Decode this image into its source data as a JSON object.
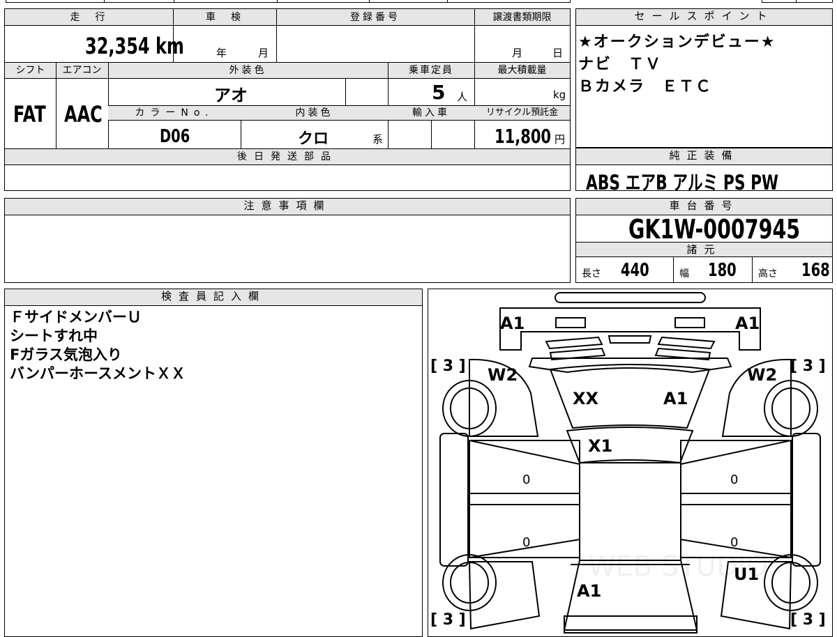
{
  "vehicle": {
    "mileage_label": "走　行",
    "mileage_value": "32,354 km",
    "inspection_label": "車　検",
    "inspection_year": "年",
    "inspection_month": "月",
    "registration_label": "登録番号",
    "transfer_label": "譲渡書類期限",
    "transfer_month": "月",
    "transfer_day": "日",
    "shift_label": "シフト",
    "shift_value": "FAT",
    "ac_label": "エアコン",
    "ac_value": "AAC",
    "exterior_label": "外装色",
    "exterior_value": "アオ",
    "capacity_label": "乗車定員",
    "capacity_value": "5",
    "capacity_unit": "人",
    "max_load_label": "最大積載量",
    "max_load_unit": "kg",
    "color_no_label": "カラーNo.",
    "color_no_value": "D06",
    "interior_label": "内装色",
    "interior_value": "クロ",
    "interior_suffix": "系",
    "import_label": "輸入車",
    "recycle_label": "リサイクル預託金",
    "recycle_value": "11,800",
    "recycle_unit": "円",
    "later_parts_label": "後日発送部品"
  },
  "sales_point": {
    "header": "セールスポイント",
    "lines": [
      "★オークションデビュー★",
      "ナビ　ＴＶ",
      "Ｂカメラ　ＥＴＣ"
    ]
  },
  "equipment": {
    "header": "純正装備",
    "value": "ABS エアB アルミ PS PW"
  },
  "caution": {
    "header": "注意事項欄"
  },
  "chassis": {
    "header": "車台番号",
    "value": "GK1W-0007945"
  },
  "specs": {
    "header": "諸元",
    "length_label": "長さ",
    "length_value": "440",
    "width_label": "幅",
    "width_value": "180",
    "height_label": "高さ",
    "height_value": "168"
  },
  "inspector": {
    "header": "検査員記入欄",
    "lines": [
      "ＦサイドメンバーＵ",
      "シートすれ中",
      "Fガラス気泡入り",
      "バンパーホースメントＸＸ"
    ]
  },
  "diagram": {
    "marks": {
      "front_left_corner": "A1",
      "front_right_corner": "A1",
      "fl_tire": "[ 3 ]",
      "fr_tire": "[ 3 ]",
      "rl_tire": "[ 3 ]",
      "rr_tire": "[ 3 ]",
      "left_fender": "W2",
      "right_fender": "W2",
      "hood_left": "XX",
      "hood_right": "A1",
      "windshield": "X1",
      "left_front_door": "0",
      "left_rear_door": "0",
      "right_front_door": "0",
      "right_rear_door": "0",
      "rear_right": "U1",
      "rear": "A1"
    },
    "watermark": "WEB STUDIO"
  }
}
